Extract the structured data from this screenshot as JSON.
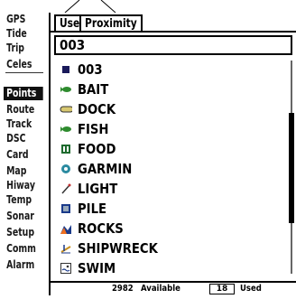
{
  "sidebar": {
    "items": [
      {
        "label": "GPS"
      },
      {
        "label": "Tide"
      },
      {
        "label": "Trip"
      },
      {
        "label": "Celes"
      },
      {
        "label": "Points"
      },
      {
        "label": "Route"
      },
      {
        "label": "Track"
      },
      {
        "label": "DSC"
      },
      {
        "label": "Card"
      },
      {
        "label": "Map"
      },
      {
        "label": "Hiway"
      },
      {
        "label": "Temp"
      },
      {
        "label": "Sonar"
      },
      {
        "label": "Setup"
      },
      {
        "label": "Comm"
      },
      {
        "label": "Alarm"
      }
    ],
    "active": "Points"
  },
  "tabs": {
    "user": "User",
    "proximity": "Proximity"
  },
  "search": {
    "value": "003"
  },
  "points": [
    {
      "label": "003",
      "icon": "square-dot-icon"
    },
    {
      "label": "BAIT",
      "icon": "fish-bait-icon"
    },
    {
      "label": "DOCK",
      "icon": "dock-icon"
    },
    {
      "label": "FISH",
      "icon": "fish-icon"
    },
    {
      "label": "FOOD",
      "icon": "food-icon"
    },
    {
      "label": "GARMIN",
      "icon": "garmin-icon"
    },
    {
      "label": "LIGHT",
      "icon": "light-icon"
    },
    {
      "label": "PILE",
      "icon": "pile-icon"
    },
    {
      "label": "ROCKS",
      "icon": "rocks-icon"
    },
    {
      "label": "SHIPWRECK",
      "icon": "shipwreck-icon"
    },
    {
      "label": "SWIM",
      "icon": "swim-icon"
    }
  ],
  "footer": {
    "available_count": "2982",
    "available_label": "Available",
    "used_count": "18",
    "used_label": "Used"
  },
  "colors": {
    "dock": "#d8c870",
    "bait": "#2e8b2e",
    "fish": "#2e8b2e",
    "food": "#1e6b2e",
    "garmin": "#2a8aa0",
    "pile": "#1a3a8a",
    "rocks_a": "#f07020",
    "rocks_b": "#1a3a8a",
    "shipwreck": "#c89020"
  }
}
